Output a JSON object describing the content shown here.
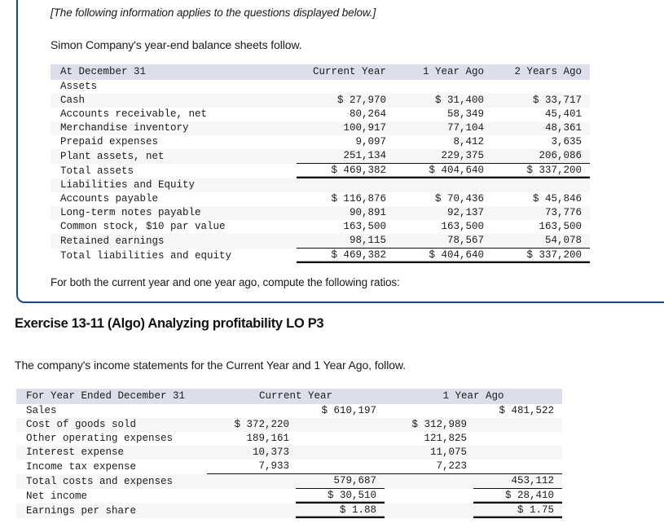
{
  "question_card": {
    "applies_note": "[The following information applies to the questions displayed below.]",
    "lead_in": "Simon Company's year-end balance sheets follow.",
    "closing": "For both the current year and one year ago, compute the following ratios:",
    "border_color": "#1b4a7a"
  },
  "balance_sheet": {
    "header": {
      "label": "At December 31",
      "col_current": "Current Year",
      "col_1yr": "1 Year Ago",
      "col_2yr": "2 Years Ago"
    },
    "assets_heading": "Assets",
    "asset_rows": [
      {
        "label": "Cash",
        "current": "$ 27,970",
        "yr1": "$ 31,400",
        "yr2": "$ 33,717"
      },
      {
        "label": "Accounts receivable, net",
        "current": "80,264",
        "yr1": "58,349",
        "yr2": "45,401"
      },
      {
        "label": "Merchandise inventory",
        "current": "100,917",
        "yr1": "77,104",
        "yr2": "48,361"
      },
      {
        "label": "Prepaid expenses",
        "current": "9,097",
        "yr1": "8,412",
        "yr2": "3,635"
      },
      {
        "label": "Plant assets, net",
        "current": "251,134",
        "yr1": "229,375",
        "yr2": "206,086"
      }
    ],
    "total_assets": {
      "label": "Total assets",
      "current": "$ 469,382",
      "yr1": "$ 404,640",
      "yr2": "$ 337,200"
    },
    "liabilities_heading": "Liabilities and Equity",
    "liability_rows": [
      {
        "label": "Accounts payable",
        "current": "$ 116,876",
        "yr1": "$ 70,436",
        "yr2": "$ 45,846"
      },
      {
        "label": "Long-term notes payable",
        "current": "90,891",
        "yr1": "92,137",
        "yr2": "73,776"
      },
      {
        "label": "Common stock, $10 par value",
        "current": "163,500",
        "yr1": "163,500",
        "yr2": "163,500"
      },
      {
        "label": "Retained earnings",
        "current": "98,115",
        "yr1": "78,567",
        "yr2": "54,078"
      }
    ],
    "total_liab_equity": {
      "label": "Total liabilities and equity",
      "current": "$ 469,382",
      "yr1": "$ 404,640",
      "yr2": "$ 337,200"
    }
  },
  "exercise": {
    "title": "Exercise 13-11 (Algo) Analyzing profitability LO P3",
    "intro": "The company's income statements for the Current Year and 1 Year Ago, follow."
  },
  "income_statement": {
    "header": {
      "label": "For Year Ended December 31",
      "col_current": "Current Year",
      "col_1yr": "1 Year Ago"
    },
    "rows": [
      {
        "label": "Sales",
        "cur_detail": "",
        "cur_total": "$ 610,197",
        "y1_detail": "",
        "y1_total": "$ 481,522"
      },
      {
        "label": "Cost of goods sold",
        "cur_detail": "$ 372,220",
        "cur_total": "",
        "y1_detail": "$ 312,989",
        "y1_total": ""
      },
      {
        "label": "Other operating expenses",
        "cur_detail": "189,161",
        "cur_total": "",
        "y1_detail": "121,825",
        "y1_total": ""
      },
      {
        "label": "Interest expense",
        "cur_detail": "10,373",
        "cur_total": "",
        "y1_detail": "11,075",
        "y1_total": ""
      },
      {
        "label": "Income tax expense",
        "cur_detail": "7,933",
        "cur_total": "",
        "y1_detail": "7,223",
        "y1_total": ""
      }
    ],
    "total_costs": {
      "label": "Total costs and expenses",
      "cur_total": "579,687",
      "y1_total": "453,112"
    },
    "net_income": {
      "label": "Net income",
      "cur_total": "$ 30,510",
      "y1_total": "$ 28,410"
    },
    "eps": {
      "label": "Earnings per share",
      "cur_total": "$ 1.88",
      "y1_total": "$ 1.75"
    }
  }
}
